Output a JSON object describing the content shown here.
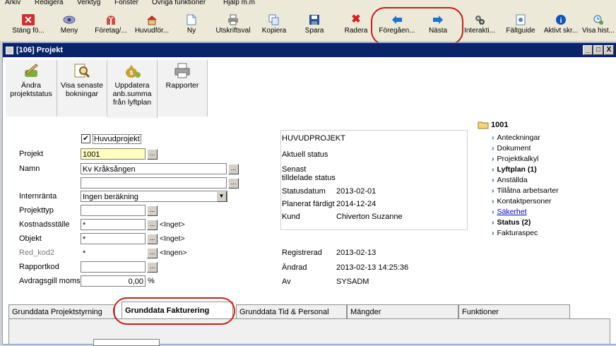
{
  "menu": [
    "Arkiv",
    "Redigera",
    "Verktyg",
    "Fönster",
    "Övriga funktioner",
    "Hjälp m.m"
  ],
  "toolbar": [
    {
      "label": "Stäng fö...",
      "icon": "close-x-icon",
      "color": "#d03030"
    },
    {
      "label": "Meny",
      "icon": "menu-eye-icon",
      "color": "#7070a0"
    },
    {
      "label": "Företag/...",
      "icon": "company-gift-icon",
      "color": "#c04040"
    },
    {
      "label": "Huvudför...",
      "icon": "house-icon",
      "color": "#b03030"
    },
    {
      "label": "Ny",
      "icon": "new-document-icon",
      "color": "#5a80c0"
    },
    {
      "label": "Utskriftsval",
      "icon": "printer-icon",
      "color": "#606060"
    },
    {
      "label": "Kopiera",
      "icon": "copy-icon",
      "color": "#5a7ac0"
    },
    {
      "label": "Spara",
      "icon": "floppy-disk-icon",
      "color": "#2050a0"
    },
    {
      "label": "Radera",
      "icon": "delete-x-icon",
      "color": "#d02020"
    },
    {
      "label": "Föregåen...",
      "icon": "arrow-left-icon",
      "color": "#2070d0"
    },
    {
      "label": "Nästa",
      "icon": "arrow-right-icon",
      "color": "#2070d0"
    },
    {
      "label": "Interakti...",
      "icon": "gears-icon",
      "color": "#505050"
    },
    {
      "label": "Fältguide",
      "icon": "field-guide-icon",
      "color": "#6080c0"
    },
    {
      "label": "Aktivt skr...",
      "icon": "info-icon",
      "color": "#1050c0"
    },
    {
      "label": "Visa hist...",
      "icon": "history-icon",
      "color": "#3070a0"
    }
  ],
  "window": {
    "title": "[106]  Projekt",
    "min": "_",
    "max": "□",
    "close": "X"
  },
  "actions": [
    {
      "label": "Ändra projektstatus",
      "icon": "edit-status-icon",
      "color": "#7fae3a"
    },
    {
      "label": "Visa senaste bokningar",
      "icon": "search-magnifier-icon",
      "color": "#d9b84a"
    },
    {
      "label": "Uppdatera anb.summa från lyftplan",
      "icon": "money-bag-icon",
      "color": "#c9a030"
    },
    {
      "label": "Rapporter",
      "icon": "report-printer-icon",
      "color": "#8a8a8a"
    }
  ],
  "form": {
    "huvudprojekt_label": "Huvudprojekt",
    "huvudprojekt_check": "✔",
    "projekt_label": "Projekt",
    "projekt_value": "1001",
    "namn_label": "Namn",
    "namn_value": "Kv Kråksången",
    "namn2_value": "",
    "internranta_label": "Internränta",
    "internranta_value": "Ingen beräkning",
    "projekttyp_label": "Projekttyp",
    "projekttyp_value": "",
    "kostnadsstalle_label": "Kostnadsställe",
    "kostnadsstalle_value": "*",
    "kostnadsstalle_hint": "<Inget>",
    "objekt_label": "Objekt",
    "objekt_value": "*",
    "objekt_hint": "<Inget>",
    "redkod_label": "Red_kod2",
    "redkod_value": "*",
    "redkod_hint": "<Ingen>",
    "rapportkod_label": "Rapportkod",
    "rapportkod_value": "",
    "avdrag_label": "Avdragsgill moms",
    "avdrag_value": "0,00",
    "avdrag_unit": "%",
    "dots": "..."
  },
  "status": {
    "heading": "HUVUDPROJEKT",
    "aktuell_label": "Aktuell status",
    "senast_label": "Senast",
    "tilldelade_label": "tilldelade status",
    "statusdatum_label": "Statusdatum",
    "statusdatum_value": "2013-02-01",
    "planerat_label": "Planerat färdigt",
    "planerat_value": "2014-12-24",
    "kund_label": "Kund",
    "kund_value": "Chiverton Suzanne",
    "registrerad_label": "Registrerad",
    "registrerad_value": "2013-02-13",
    "andrad_label": "Ändrad",
    "andrad_value": "2013-02-13 14:25:36",
    "av_label": "Av",
    "av_value": "SYSADM"
  },
  "tree": {
    "root": "1001",
    "items": [
      {
        "label": "Anteckningar"
      },
      {
        "label": "Dokument"
      },
      {
        "label": "Projektkalkyl"
      },
      {
        "label": "Lyftplan (1)",
        "bold": true
      },
      {
        "label": "Anställda"
      },
      {
        "label": "Tillåtna arbetsarter"
      },
      {
        "label": "Kontaktpersoner"
      },
      {
        "label": "Säkerhet",
        "link": true
      },
      {
        "label": "Status (2)",
        "bold": true
      },
      {
        "label": "Fakturaspec"
      }
    ],
    "chevron": "›"
  },
  "tabs": [
    {
      "label": "Grunddata Projektstyrning"
    },
    {
      "label": "Grunddata Fakturering",
      "active": true
    },
    {
      "label": "Grunddata Tid & Personal"
    },
    {
      "label": "Mängder"
    },
    {
      "label": "Funktioner"
    }
  ]
}
